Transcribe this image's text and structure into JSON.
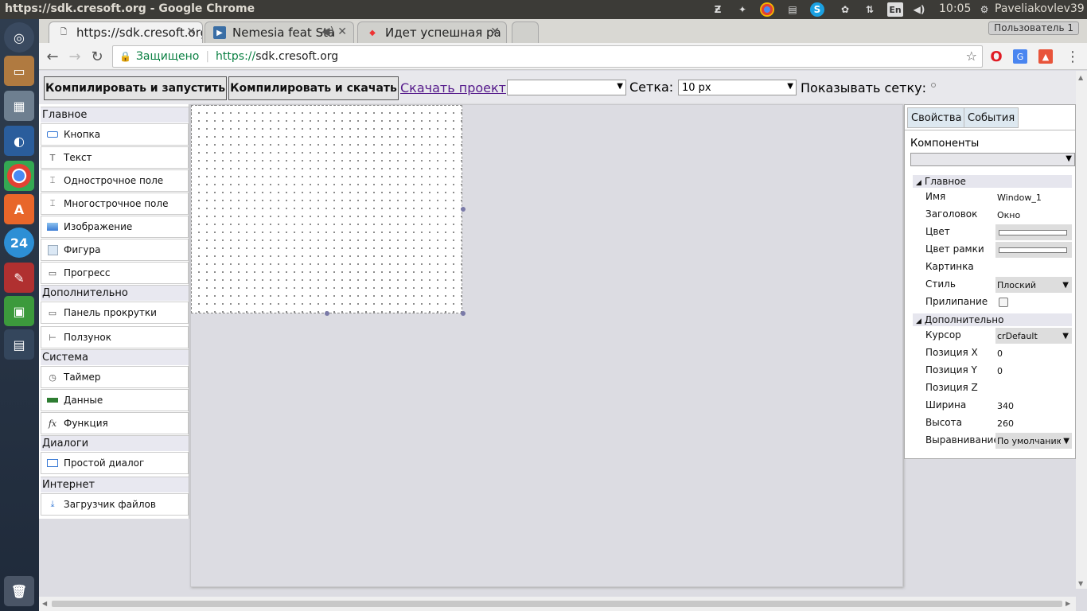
{
  "system": {
    "window_title": "https://sdk.cresoft.org - Google Chrome",
    "keyboard_layout": "En",
    "time": "10:05",
    "user": "Paveliakovlev39"
  },
  "chrome": {
    "tabs": [
      {
        "label": "https://sdk.cresoft.org",
        "active": true
      },
      {
        "label": "Nemesia feat Sta",
        "active": false
      },
      {
        "label": "Идет успешная ра",
        "active": false
      }
    ],
    "user_button": "Пользователь 1",
    "secure_label": "Защищено",
    "url_scheme": "https://",
    "url_host": "sdk.cresoft.org"
  },
  "toolbar": {
    "compile_run": "Компилировать и запустить",
    "compile_download": "Компилировать и скачать",
    "download_project": "Скачать проект",
    "form_select_value": "",
    "grid_label": "Сетка:",
    "grid_value": "10 px",
    "show_grid_label": "Показывать сетку:"
  },
  "palette": {
    "categories": [
      {
        "name": "Главное",
        "items": [
          "Кнопка",
          "Текст",
          "Однострочное поле",
          "Многострочное поле",
          "Изображение",
          "Фигура",
          "Прогресс"
        ]
      },
      {
        "name": "Дополнительно",
        "items": [
          "Панель прокрутки",
          "Ползунок"
        ]
      },
      {
        "name": "Система",
        "items": [
          "Таймер",
          "Данные",
          "Функция"
        ]
      },
      {
        "name": "Диалоги",
        "items": [
          "Простой диалог"
        ]
      },
      {
        "name": "Интернет",
        "items": [
          "Загрузчик файлов"
        ]
      }
    ]
  },
  "properties": {
    "tab_props": "Свойства",
    "tab_events": "События",
    "components_label": "Компоненты",
    "components_value": "",
    "section_main": "Главное",
    "section_extra": "Дополнительно",
    "main_rows": [
      {
        "key": "Имя",
        "value": "Window_1"
      },
      {
        "key": "Заголовок",
        "value": "Окно"
      },
      {
        "key": "Цвет",
        "value": ""
      },
      {
        "key": "Цвет рамки",
        "value": ""
      },
      {
        "key": "Картинка",
        "value": ""
      },
      {
        "key": "Стиль",
        "value": "Плоский"
      },
      {
        "key": "Прилипание",
        "value": ""
      }
    ],
    "extra_rows": [
      {
        "key": "Курсор",
        "value": "crDefault"
      },
      {
        "key": "Позиция X",
        "value": "0"
      },
      {
        "key": "Позиция Y",
        "value": "0"
      },
      {
        "key": "Позиция Z",
        "value": ""
      },
      {
        "key": "Ширина",
        "value": "340"
      },
      {
        "key": "Высота",
        "value": "260"
      },
      {
        "key": "Выравнивание",
        "value": "По умолчанию"
      }
    ]
  }
}
